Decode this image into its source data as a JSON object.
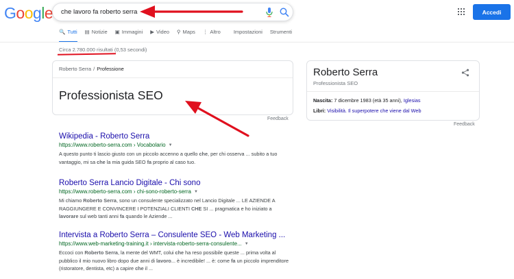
{
  "header": {
    "logo_letters": [
      {
        "char": "G",
        "color": "#4285F4"
      },
      {
        "char": "o",
        "color": "#EA4335"
      },
      {
        "char": "o",
        "color": "#FBBC05"
      },
      {
        "char": "g",
        "color": "#4285F4"
      },
      {
        "char": "l",
        "color": "#34A853"
      },
      {
        "char": "e",
        "color": "#EA4335"
      }
    ],
    "search_query": "che lavoro fa roberto serra",
    "signin_label": "Accedi"
  },
  "tabs": [
    {
      "label": "Tutti",
      "icon": "search-icon",
      "glyph": "🔍",
      "active": true
    },
    {
      "label": "Notizie",
      "icon": "news-icon",
      "glyph": "▤",
      "active": false
    },
    {
      "label": "Immagini",
      "icon": "image-icon",
      "glyph": "▣",
      "active": false
    },
    {
      "label": "Video",
      "icon": "video-icon",
      "glyph": "▶",
      "active": false
    },
    {
      "label": "Maps",
      "icon": "map-pin-icon",
      "glyph": "⚲",
      "active": false
    },
    {
      "label": "Altro",
      "icon": "more-icon",
      "glyph": "⋮",
      "active": false
    },
    {
      "label": "Impostazioni",
      "icon": "",
      "glyph": "",
      "active": false
    },
    {
      "label": "Strumenti",
      "icon": "",
      "glyph": "",
      "active": false
    }
  ],
  "result_stats": "Circa 2.780.000 risultati (0,53 secondi)",
  "featured_snippet": {
    "breadcrumb_parent": "Roberto Serra",
    "breadcrumb_separator": "/",
    "breadcrumb_current": "Professione",
    "answer": "Professionista SEO",
    "feedback": "Feedback"
  },
  "knowledge_panel": {
    "title": "Roberto Serra",
    "subtitle": "Professionista SEO",
    "birth_label": "Nascita:",
    "birth_value": " 7 dicembre 1983 (età 35 anni), ",
    "birth_place": "Iglesias",
    "books_label": "Libri:",
    "books_value": "Visibilità. Il superpotere che viene dal Web",
    "feedback": "Feedback"
  },
  "results": [
    {
      "title": "Wikipedia - Roberto Serra",
      "url": "https://www.roberto-serra.com › Vocabolario",
      "snippet_html": "A questo punto ti lascio giusto con un piccolo accenno a quello <b>che</b>, per chi osserva ... subito a tuo vantaggio, mi sa <b>che</b> la mia guida SEO <b>fa</b> proprio al caso tuo."
    },
    {
      "title": "Roberto Serra Lancio Digitale - Chi sono",
      "url": "https://www.roberto-serra.com › chi-sono-roberto-serra",
      "snippet_html": "Mi chiamo <b>Roberto Serra</b>, sono un consulente specializzato nel Lancio Digitale ... LE AZIENDE A RAGGIUNGERE E CONVINCERE I POTENZIALI CLIENTI <b>CHE</b> SI ... pragmatica e ho iniziato a <b>lavorare</b> sul web tanti anni <b>fa</b> quando le Aziende ..."
    },
    {
      "title": "Intervista a Roberto Serra – Consulente SEO - Web Marketing ...",
      "url": "https://www.web-marketing-training.it › intervista-roberto-serra-consulente...",
      "snippet_html": "Eccoci con <b>Roberto Serra</b>, la mente del WMT, colui <b>che</b> ha reso possibile queste ... prima volta al pubblico il mio nuovo libro dopo due anni di <b>lavoro</b>... è incredibile! ... è: come <b>fa</b> un piccolo imprenditore (ristoratore, dentista, etc) a capire <b>che</b> il ..."
    }
  ],
  "colors": {
    "link": "#1a0dab",
    "url_green": "#006621",
    "accent_blue": "#1a73e8",
    "annotation_red": "#e0101e"
  }
}
